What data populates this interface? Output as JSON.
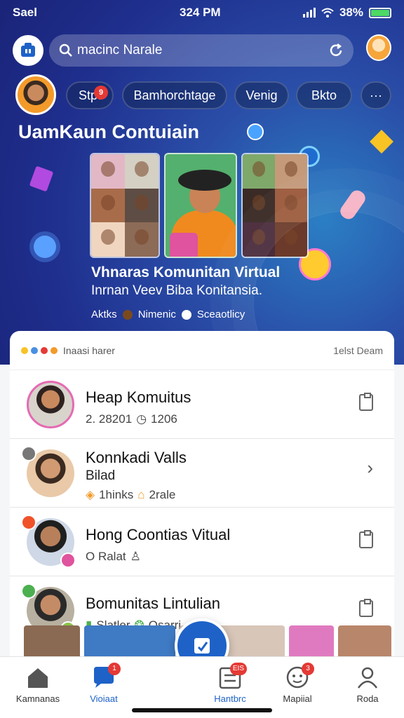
{
  "status_bar": {
    "carrier": "Sael",
    "time": "324 PM",
    "battery": "38%"
  },
  "search": {
    "placeholder": "macinc Narale"
  },
  "chips": [
    {
      "label": "Stpt",
      "badge": "9"
    },
    {
      "label": "Bamhorchtage"
    },
    {
      "label": "Venig"
    },
    {
      "label": "Bkto"
    }
  ],
  "hero": {
    "title": "UamKaun Contuiain",
    "subtitle": "Vhnaras Komunitan Virtual",
    "tagline": "Inrnan Veev Biba Konitansia.",
    "tags": [
      {
        "label": "Aktks",
        "color": "#a0c4ff"
      },
      {
        "label": "Nimenic",
        "color": "#7a4a1e"
      },
      {
        "label": "Sceaotlicy",
        "color": "#ffffff"
      }
    ]
  },
  "panel": {
    "header_left": "Inaasi harer",
    "header_right": "1elst Deam",
    "rows": [
      {
        "title": "Heap Komuitus",
        "meta1": "2. 28201",
        "meta2": "1206"
      },
      {
        "title": "Konnkadi Valls",
        "subtitle": "Bilad",
        "meta1": "1hinks",
        "meta2": "2rale"
      },
      {
        "title": "Hong Coontias Vitual",
        "meta1": "O Ralat",
        "meta2": ""
      },
      {
        "title": "Bomunitas Lintulian",
        "meta1": "Slatler",
        "meta2": "Osarri"
      }
    ]
  },
  "bottom_nav": [
    {
      "label": "Kamnanas",
      "icon": "home-icon"
    },
    {
      "label": "Vioiaat",
      "icon": "chat-icon",
      "badge": "1"
    },
    {
      "label": "Hantbrc",
      "icon": "news-icon",
      "badge": "EIS"
    },
    {
      "label": "Mapiial",
      "icon": "smile-icon",
      "badge": "3"
    },
    {
      "label": "Roda",
      "icon": "profile-icon"
    }
  ],
  "colors": {
    "accent": "#1e62c8",
    "hero_bg": "#2a4ea8",
    "badge": "#e53935"
  }
}
